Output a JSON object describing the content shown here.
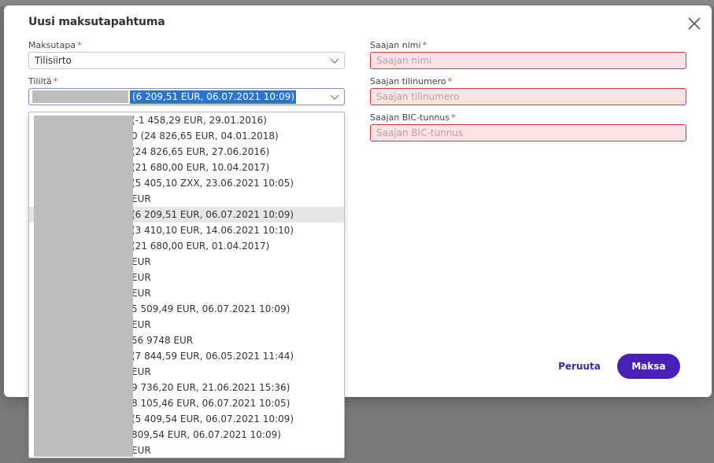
{
  "modal": {
    "title": "Uusi maksutapahtuma",
    "close_icon": "close-icon"
  },
  "fields": {
    "payment_method": {
      "label": "Maksutapa",
      "required_mark": "*",
      "value": "Tilisiirto"
    },
    "from_account": {
      "label": "Tililtä",
      "required_mark": "*",
      "selected_suffix": "(6 209,51 EUR, 06.07.2021 10:09)"
    },
    "recipient_name": {
      "label": "Saajan nimi",
      "required_mark": "*",
      "placeholder": "Saajan nimi",
      "value": ""
    },
    "recipient_account": {
      "label": "Saajan tilinumero",
      "required_mark": "*",
      "placeholder": "Saajan tilinumero",
      "value": ""
    },
    "recipient_bic": {
      "label": "Saajan BIC-tunnus",
      "required_mark": "*",
      "placeholder": "Saajan BIC-tunnus",
      "value": ""
    }
  },
  "account_options": [
    {
      "text": "(-1 458,29 EUR, 29.01.2016)",
      "selected": false
    },
    {
      "text": "0 (24 826,65 EUR, 04.01.2018)",
      "selected": false
    },
    {
      "text": "(24 826,65 EUR, 27.06.2016)",
      "selected": false
    },
    {
      "text": "(21 680,00 EUR, 10.04.2017)",
      "selected": false
    },
    {
      "text": "(5 405,10 ZXX, 23.06.2021 10:05)",
      "selected": false
    },
    {
      "text": "EUR",
      "selected": false
    },
    {
      "text": "(6 209,51 EUR, 06.07.2021 10:09)",
      "selected": true
    },
    {
      "text": "(3 410,10 EUR, 14.06.2021 10:10)",
      "selected": false
    },
    {
      "text": "(21 680,00 EUR, 01.04.2017)",
      "selected": false
    },
    {
      "text": "EUR",
      "selected": false
    },
    {
      "text": "EUR",
      "selected": false
    },
    {
      "text": "EUR",
      "selected": false
    },
    {
      "text": "5 509,49 EUR, 06.07.2021 10:09)",
      "selected": false
    },
    {
      "text": "EUR",
      "selected": false
    },
    {
      "text": "56 9748 EUR",
      "selected": false
    },
    {
      "text": "(7 844,59 EUR, 06.05.2021 11:44)",
      "selected": false
    },
    {
      "text": "EUR",
      "selected": false
    },
    {
      "text": "9 736,20 EUR, 21.06.2021 15:36)",
      "selected": false
    },
    {
      "text": "8 105,46 EUR, 06.07.2021 10:05)",
      "selected": false
    },
    {
      "text": "(5 409,54 EUR, 06.07.2021 10:09)",
      "selected": false
    },
    {
      "text": "809,54 EUR, 06.07.2021 10:09)",
      "selected": false
    },
    {
      "text": "EUR",
      "selected": false
    }
  ],
  "actions": {
    "cancel_label": "Peruuta",
    "pay_label": "Maksa"
  },
  "colors": {
    "primary": "#4a1fb8",
    "error_border": "#d63a3a",
    "error_bg": "#fde3e5",
    "selection": "#2b72d3"
  }
}
